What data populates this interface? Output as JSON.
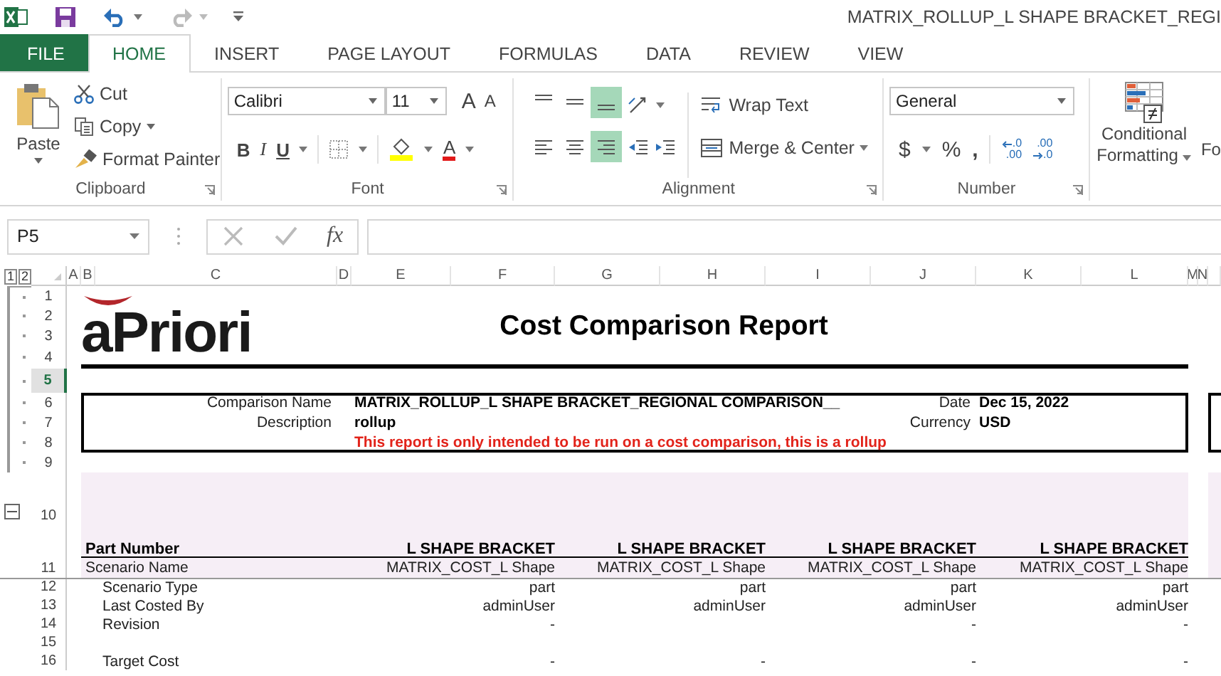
{
  "title_bar": {
    "title": "MATRIX_ROLLUP_L SHAPE BRACKET_REGI"
  },
  "tabs": [
    {
      "label": "FILE",
      "kind": "file",
      "selected": false
    },
    {
      "label": "HOME",
      "kind": "tab",
      "selected": true
    },
    {
      "label": "INSERT",
      "kind": "tab",
      "selected": false
    },
    {
      "label": "PAGE LAYOUT",
      "kind": "tab",
      "selected": false
    },
    {
      "label": "FORMULAS",
      "kind": "tab",
      "selected": false
    },
    {
      "label": "DATA",
      "kind": "tab",
      "selected": false
    },
    {
      "label": "REVIEW",
      "kind": "tab",
      "selected": false
    },
    {
      "label": "VIEW",
      "kind": "tab",
      "selected": false
    }
  ],
  "ribbon": {
    "clipboard": {
      "label": "Clipboard",
      "paste": "Paste",
      "cut": "Cut",
      "copy": "Copy",
      "format_painter": "Format Painter"
    },
    "font": {
      "label": "Font",
      "name": "Calibri",
      "size": "11",
      "grow": "A",
      "shrink": "A",
      "bold": "B",
      "italic": "I",
      "underline": "U",
      "font_color_button": "A"
    },
    "alignment": {
      "label": "Alignment",
      "wrap_text": "Wrap Text",
      "merge_center": "Merge & Center",
      "buttons": [
        {
          "kind": "top",
          "selected": false
        },
        {
          "kind": "middle",
          "selected": false
        },
        {
          "kind": "bottom",
          "selected": true
        },
        {
          "kind": "left",
          "selected": false
        },
        {
          "kind": "center",
          "selected": false
        },
        {
          "kind": "right",
          "selected": true
        }
      ]
    },
    "number": {
      "label": "Number",
      "format": "General",
      "currency": "$",
      "percent": "%",
      "comma": ",",
      "decimals": [
        {
          "kind": "increase",
          "top": ".0",
          "bottom": ".00"
        },
        {
          "kind": "decrease",
          "top": ".00",
          "bottom": ".0"
        }
      ]
    },
    "styles": {
      "conditional_formatting": "Conditional",
      "conditional_formatting_2": "Formatting",
      "next_button": "Fo"
    }
  },
  "formula_bar": {
    "name_box": "P5",
    "function_label": "fx"
  },
  "sheet": {
    "outline_levels": [
      "1",
      "2"
    ],
    "columns": [
      "A",
      "B",
      "C",
      "D",
      "E",
      "F",
      "G",
      "H",
      "I",
      "J",
      "K",
      "L",
      "M",
      "N"
    ],
    "rows": [
      {
        "label": "1",
        "selected": false
      },
      {
        "label": "2",
        "selected": false
      },
      {
        "label": "3",
        "selected": false
      },
      {
        "label": "4",
        "selected": false
      },
      {
        "label": "5",
        "selected": true
      },
      {
        "label": "6",
        "selected": false
      },
      {
        "label": "7",
        "selected": false
      },
      {
        "label": "8",
        "selected": false
      },
      {
        "label": "9",
        "selected": false
      },
      {
        "label": "10",
        "selected": false
      },
      {
        "label": "11",
        "selected": false
      },
      {
        "label": "12",
        "selected": false
      },
      {
        "label": "13",
        "selected": false
      },
      {
        "label": "14",
        "selected": false
      },
      {
        "label": "15",
        "selected": false
      },
      {
        "label": "16",
        "selected": false
      }
    ]
  },
  "report": {
    "logo": "aPriori",
    "title": "Cost Comparison Report",
    "fields": [
      {
        "label": "Comparison Name",
        "value": "MATRIX_ROLLUP_L SHAPE BRACKET_REGIONAL COMPARISON__"
      },
      {
        "label": "Description",
        "value": "rollup"
      }
    ],
    "side_fields": [
      {
        "label": "Date",
        "value": "Dec 15, 2022"
      },
      {
        "label": "Currency",
        "value": "USD"
      }
    ],
    "warning": "This report is only intended to be run on a cost comparison, this is a rollup",
    "table": {
      "header_label": "Part Number",
      "parts": [
        "L SHAPE BRACKET",
        "L SHAPE BRACKET",
        "L SHAPE BRACKET",
        "L SHAPE BRACKET"
      ],
      "rows": [
        {
          "kind": "main",
          "label": "Scenario Name",
          "values": {
            "part_1": "MATRIX_COST_L Shape",
            "part_2": "MATRIX_COST_L Shape",
            "part_3": "MATRIX_COST_L Shape",
            "part_4": "MATRIX_COST_L Shape"
          }
        },
        {
          "kind": "sub",
          "label": "Scenario Type",
          "values": {
            "part_1": "part",
            "part_2": "part",
            "part_3": "part",
            "part_4": "part"
          }
        },
        {
          "kind": "sub",
          "label": "Last Costed By",
          "values": {
            "part_1": "adminUser",
            "part_2": "adminUser",
            "part_3": "adminUser",
            "part_4": "adminUser"
          }
        },
        {
          "kind": "sub",
          "label": "Revision",
          "values": {
            "part_1": "-",
            "part_3": "-",
            "part_4": "-"
          }
        },
        {
          "kind": "blank"
        },
        {
          "kind": "sub",
          "label": "Target Cost",
          "values": {
            "part_1": "-",
            "part_2": "-",
            "part_3": "-",
            "part_4": "-"
          }
        }
      ]
    }
  }
}
